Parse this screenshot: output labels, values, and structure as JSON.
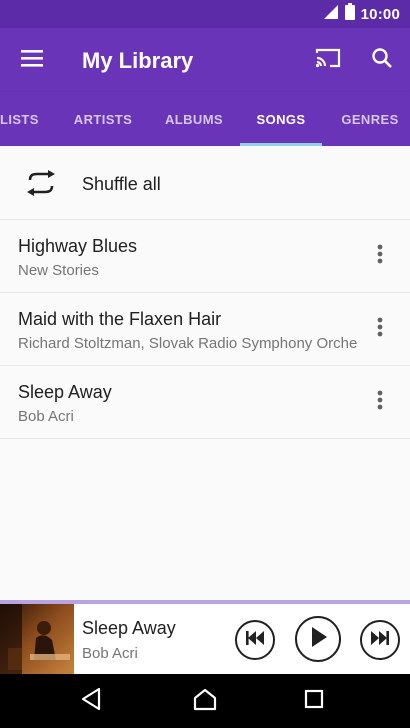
{
  "status_bar": {
    "time": "10:00"
  },
  "app_bar": {
    "title": "My Library"
  },
  "tabs": [
    {
      "label": "LISTS"
    },
    {
      "label": "ARTISTS"
    },
    {
      "label": "ALBUMS"
    },
    {
      "label": "SONGS",
      "active": true
    },
    {
      "label": "GENRES"
    }
  ],
  "shuffle": {
    "label": "Shuffle all"
  },
  "songs": [
    {
      "title": "Highway Blues",
      "artist": "New Stories"
    },
    {
      "title": "Maid with the Flaxen Hair",
      "artist": "Richard Stoltzman, Slovak Radio Symphony Orchestra"
    },
    {
      "title": "Sleep Away",
      "artist": "Bob Acri"
    }
  ],
  "now_playing": {
    "title": "Sleep Away",
    "artist": "Bob Acri"
  },
  "colors": {
    "status_bar": "#5b2ba8",
    "app_bar": "#6a34b8",
    "tab_indicator": "#8fd3e6",
    "player_accent": "#b9a3e3"
  },
  "icons": {
    "status": [
      "signal-icon",
      "battery-icon"
    ],
    "app_bar": [
      "menu-icon",
      "cast-icon",
      "search-icon"
    ],
    "list": [
      "shuffle-icon",
      "more-vert-icon"
    ],
    "player": [
      "skip-previous-icon",
      "play-icon",
      "skip-next-icon"
    ],
    "nav": [
      "back-icon",
      "home-icon",
      "recents-icon"
    ]
  }
}
